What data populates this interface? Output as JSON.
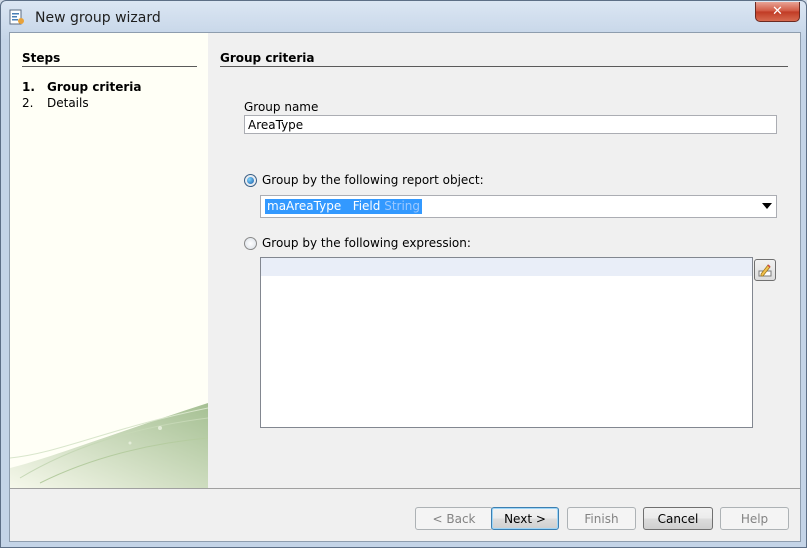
{
  "window": {
    "title": "New group wizard"
  },
  "steps": {
    "title": "Steps",
    "items": [
      {
        "num": "1.",
        "label": "Group criteria"
      },
      {
        "num": "2.",
        "label": "Details"
      }
    ]
  },
  "content": {
    "title": "Group criteria",
    "group_name_label": "Group name",
    "group_name_value": "AreaType",
    "option_report_object": "Group by the following report object:",
    "report_object_name": "maAreaType",
    "report_object_kind": "Field",
    "report_object_type": "String",
    "option_expression": "Group by the following expression:",
    "expression_value": ""
  },
  "buttons": {
    "back": "< Back",
    "next": "Next >",
    "finish": "Finish",
    "cancel": "Cancel",
    "help": "Help"
  },
  "colors": {
    "selection": "#3399ff",
    "close": "#c94a33"
  }
}
